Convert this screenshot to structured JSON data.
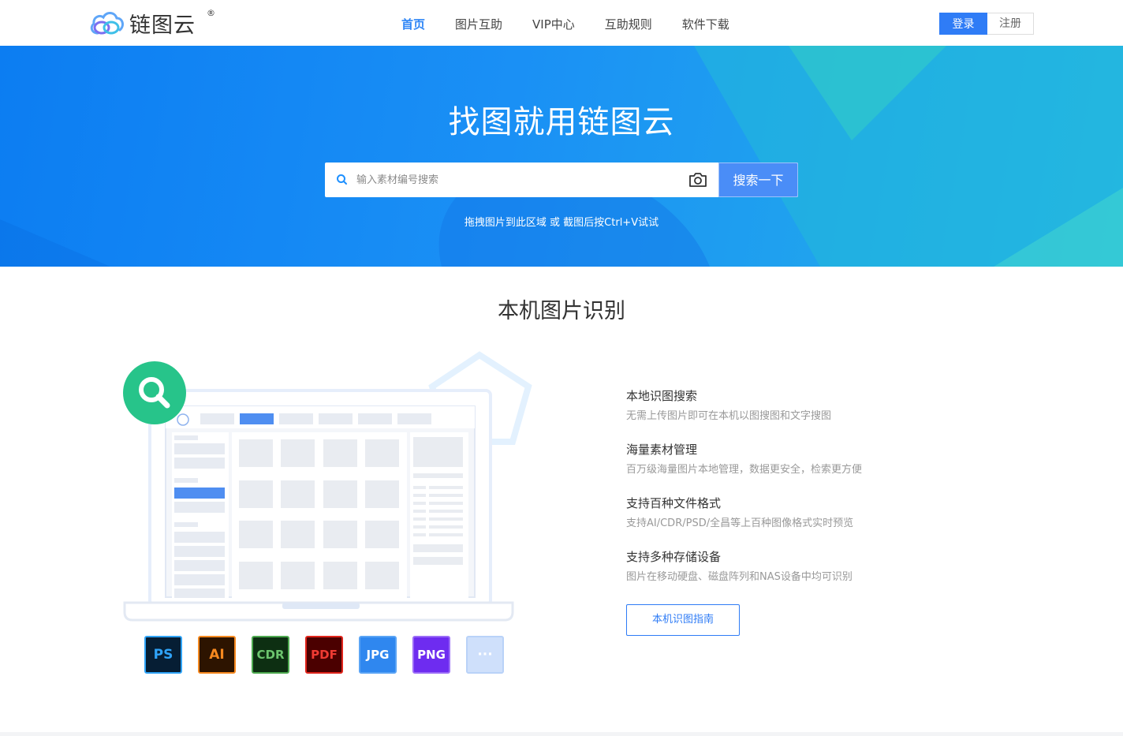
{
  "header": {
    "logo_text": "链图云",
    "logo_reg": "®",
    "nav": [
      {
        "label": "首页",
        "active": true
      },
      {
        "label": "图片互助",
        "active": false
      },
      {
        "label": "VIP中心",
        "active": false
      },
      {
        "label": "互助规则",
        "active": false
      },
      {
        "label": "软件下载",
        "active": false
      }
    ],
    "login_label": "登录",
    "register_label": "注册"
  },
  "hero": {
    "title": "找图就用链图云",
    "search_placeholder": "输入素材编号搜索",
    "search_button": "搜索一下",
    "hint": "拖拽图片到此区域 或 截图后按Ctrl+V试试"
  },
  "section": {
    "title": "本机图片识别",
    "features": [
      {
        "title": "本地识图搜索",
        "desc": "无需上传图片即可在本机以图搜图和文字搜图"
      },
      {
        "title": "海量素材管理",
        "desc": "百万级海量图片本地管理，数据更安全，检索更方便"
      },
      {
        "title": "支持百种文件格式",
        "desc": "支持AI/CDR/PSD/全昌等上百种图像格式实时预览"
      },
      {
        "title": "支持多种存储设备",
        "desc": "图片在移动硬盘、磁盘阵列和NAS设备中均可识别"
      }
    ],
    "guide_button": "本机识图指南",
    "formats": [
      {
        "label": "PS",
        "bg": "#061e34",
        "border": "#2fa3f7",
        "color": "#2fa3f7"
      },
      {
        "label": "AI",
        "bg": "#2d1400",
        "border": "#f7891f",
        "color": "#f7891f"
      },
      {
        "label": "CDR",
        "bg": "#0d2f12",
        "border": "#4da94f",
        "color": "#6cc46e"
      },
      {
        "label": "PDF",
        "bg": "#4b0000",
        "border": "#e0241b",
        "color": "#ef3b33"
      },
      {
        "label": "JPG",
        "bg": "#2f87ef",
        "border": "#5aa4f5",
        "color": "#ffffff"
      },
      {
        "label": "PNG",
        "bg": "#6e2cf0",
        "border": "#9b6cf7",
        "color": "#ffffff"
      },
      {
        "label": "···",
        "bg": "#cfe0fb",
        "border": "#b9d2f8",
        "color": "#ffffff"
      }
    ]
  },
  "colors": {
    "primary": "#2f7cf6",
    "search_accent": "#1e90ff",
    "icon_green": "#27c48a"
  }
}
